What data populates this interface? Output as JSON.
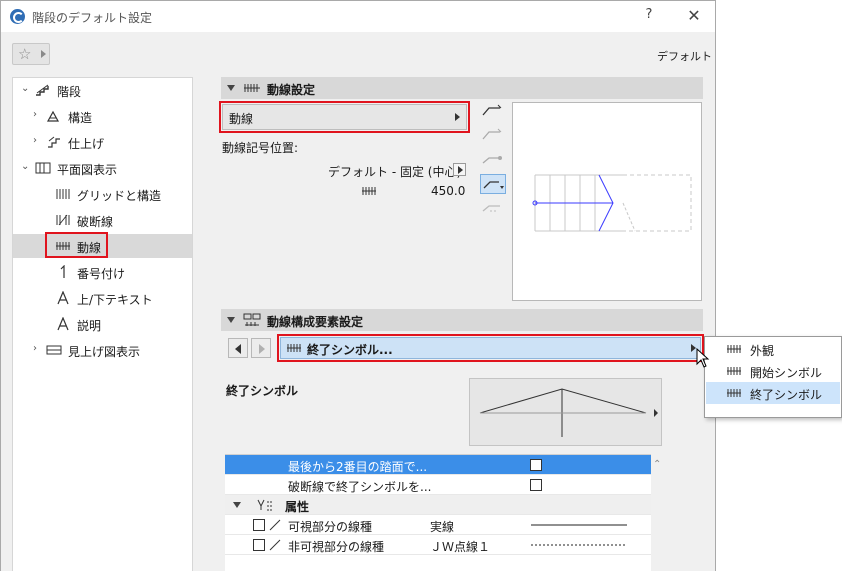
{
  "window": {
    "title": "階段のデフォルト設定",
    "help": "?",
    "close": "✕"
  },
  "header": {
    "default_label": "デフォルト"
  },
  "tree": {
    "items": [
      {
        "label": "階段",
        "icon": "stair-icon"
      },
      {
        "label": "構造",
        "icon": "structure-icon"
      },
      {
        "label": "仕上げ",
        "icon": "finish-icon"
      },
      {
        "label": "平面図表示",
        "icon": "floorplan-icon"
      },
      {
        "label": "グリッドと構造",
        "icon": "grid-icon"
      },
      {
        "label": "破断線",
        "icon": "break-line-icon"
      },
      {
        "label": "動線",
        "icon": "walking-line-icon",
        "selected": true
      },
      {
        "label": "番号付け",
        "icon": "numbering-icon"
      },
      {
        "label": "上/下テキスト",
        "icon": "up-down-text-icon"
      },
      {
        "label": "説明",
        "icon": "description-icon"
      },
      {
        "label": "見上げ図表示",
        "icon": "reflected-view-icon"
      }
    ]
  },
  "walking_line": {
    "section_title": "動線設定",
    "dropdown_value": "動線",
    "symbol_position_label": "動線記号位置:",
    "position_value": "デフォルト - 固定 (中心)",
    "offset_value": "450.0"
  },
  "components": {
    "section_title": "動線構成要素設定",
    "selected_component": "終了シンボル..."
  },
  "end_symbol": {
    "label": "終了シンボル"
  },
  "table": {
    "rows": [
      {
        "label": "最後から2番目の踏面で...",
        "checked": false,
        "selected": true
      },
      {
        "label": "破断線で終了シンボルを...",
        "checked": false
      },
      {
        "label": "属性",
        "group": true
      },
      {
        "label": "可視部分の線種",
        "value": "実線"
      },
      {
        "label": "非可視部分の線種",
        "value": "ＪＷ点線１"
      }
    ]
  },
  "popup": {
    "items": [
      {
        "label": "外観"
      },
      {
        "label": "開始シンボル"
      },
      {
        "label": "終了シンボル",
        "selected": true
      }
    ]
  },
  "colors": {
    "highlight_red": "#e0141e",
    "selection_blue": "#3b8ee8",
    "light_blue": "#cde2f6"
  }
}
